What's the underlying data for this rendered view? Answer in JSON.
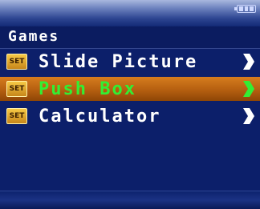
{
  "title": "Games",
  "menu": {
    "items": [
      {
        "icon": "SET",
        "label": "Slide Picture",
        "selected": false
      },
      {
        "icon": "SET",
        "label": "Push Box",
        "selected": true
      },
      {
        "icon": "SET",
        "label": "Calculator",
        "selected": false
      }
    ]
  },
  "colors": {
    "background": "#0c1f6a",
    "selected_bg": "#c0651a",
    "selected_text": "#33ee33",
    "text": "#ffffff"
  },
  "status": {
    "battery_icon": "battery-icon"
  }
}
